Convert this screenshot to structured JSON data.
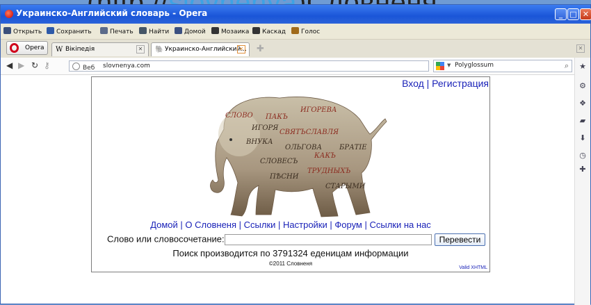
{
  "overlay": {
    "prefix": "(http://",
    "link": "slovnenya",
    "suffix": ")Словненя"
  },
  "window": {
    "title": "Украинско-Английский словарь - Opera"
  },
  "menubar": {
    "items": [
      "Открыть",
      "Сохранить",
      "Печать",
      "Найти",
      "Домой",
      "Мозаика",
      "Каскад",
      "Голос"
    ]
  },
  "tabs": {
    "opera_label": "Opera",
    "items": [
      {
        "label": "Вікіпедія",
        "favicon": "W"
      },
      {
        "label": "Украинско-Английский...",
        "favicon": "🐘"
      }
    ]
  },
  "address": {
    "label": "Веб",
    "url": "slovnenya.com"
  },
  "search": {
    "engine": "Polyglossum"
  },
  "page": {
    "auth": {
      "login": "Вход",
      "separator": " | ",
      "register": "Регистрация"
    },
    "nav": [
      "Домой",
      "О Словненя",
      "Ссылки",
      "Настройки",
      "Форум",
      "Ссылки на нас"
    ],
    "search_label": "Слово или словосочетание:",
    "search_value": "",
    "submit_label": "Перевести",
    "info": "Поиск производится по 3791324 еденицам информации",
    "copyright": "©2011 Словненя",
    "valid": "Valid XHTML",
    "elephant_text": [
      "СЛОВО",
      "ПАКЪ",
      "ИГОРЕВА",
      "ИГОРЯ",
      "СВЯТЪСЛАВЛЯ",
      "ВНУКА",
      "ОЛЬГОВА",
      "КАКЪ",
      "БРАТІЕ",
      "СЛОВЕСЪ",
      "ТРУДНЫХЪ",
      "ПѢСНИ",
      "СТАРЫМИ"
    ]
  },
  "colors": {
    "link": "#1a22b8",
    "titlebar": "#2358d8",
    "overlay_link": "#3ea3e4"
  }
}
